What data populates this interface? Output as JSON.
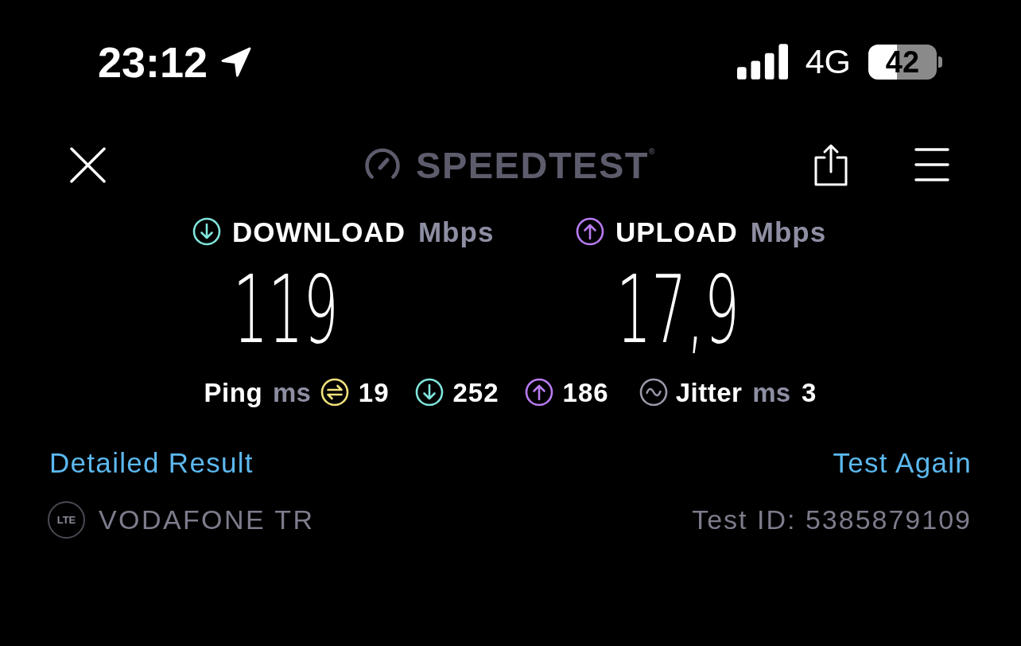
{
  "status_bar": {
    "time": "23:12",
    "network": "4G",
    "battery": "42"
  },
  "header": {
    "logo": "SPEEDTEST$^{®}$"
  },
  "results": [
    {
      "kind": "download",
      "label": "DOWNLOAD",
      "unit": "Mbps",
      "value": "119",
      "color": "#80e6de"
    },
    {
      "kind": "upload",
      "label": "UPLOAD",
      "unit": "Mbps",
      "value": "17,9",
      "color": "#b97cf2"
    }
  ],
  "ping": {
    "label": "Ping",
    "unit": "ms",
    "readings": [
      {
        "kind": "idle",
        "value": "19",
        "color": "#f2e27e"
      },
      {
        "kind": "download",
        "value": "252",
        "color": "#80e6de"
      },
      {
        "kind": "upload",
        "value": "186",
        "color": "#b97cf2"
      }
    ]
  },
  "jitter": {
    "label": "Jitter",
    "unit": "ms",
    "value": "3"
  },
  "links": [
    {
      "text": "Detailed Result"
    },
    {
      "text": "Test Again"
    }
  ],
  "connection": {
    "network_type": "LTE",
    "carrier": "VODAFONE TR",
    "test_id": "Test ID: 5385879109"
  }
}
